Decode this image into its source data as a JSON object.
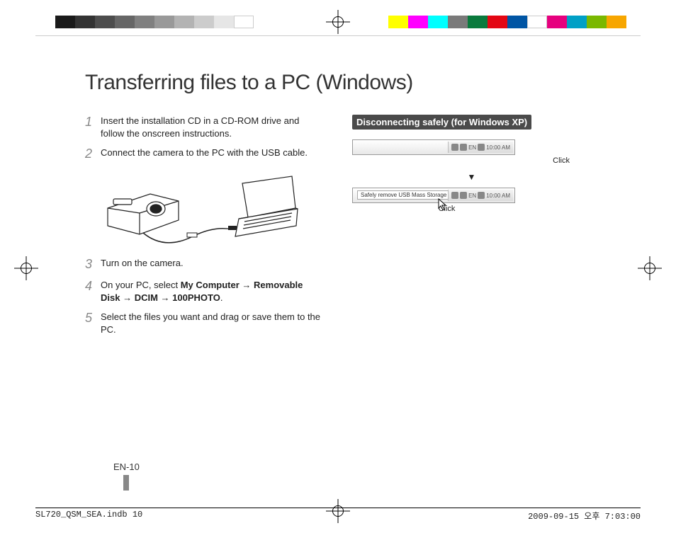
{
  "title": "Transferring files to a PC (Windows)",
  "steps": {
    "s1": {
      "num": "1",
      "text": "Insert the installation CD in a CD-ROM drive and follow the onscreen instructions."
    },
    "s2": {
      "num": "2",
      "text": "Connect the camera to the PC with the USB cable."
    },
    "s3": {
      "num": "3",
      "text": "Turn on the camera."
    },
    "s4": {
      "num": "4",
      "prefix": "On your PC, select ",
      "b1": "My Computer",
      "arr1": " → ",
      "b2": "Removable Disk",
      "arr2": " → ",
      "b3": "DCIM",
      "arr3": " → ",
      "b4": "100PHOTO",
      "suffix": "."
    },
    "s5": {
      "num": "5",
      "text": "Select the files you want and drag or save them to the PC."
    }
  },
  "right": {
    "heading": "Disconnecting safely (for Windows XP)",
    "tray_time": "10:00 AM",
    "tray_lang": "EN",
    "balloon": "Safely remove USB Mass Storage Device - Drive(H:)",
    "click": "Click",
    "arrow": "▼"
  },
  "pagenum": "EN-10",
  "footer": {
    "left": "SL720_QSM_SEA.indb   10",
    "right": "2009-09-15   오후 7:03:00"
  },
  "colorbar_gray": [
    "#1a1a1a",
    "#333",
    "#4d4d4d",
    "#666",
    "#808080",
    "#999",
    "#b3b3b3",
    "#ccc",
    "#e6e6e6",
    "#fff"
  ],
  "colorbar_color": [
    "#ff0",
    "#f0f",
    "#0ff",
    "#7a7a7a",
    "#0a7a3d",
    "#e30613",
    "#0055a4",
    "#fff",
    "#e6007e",
    "#00a0c6",
    "#7ab800",
    "#f7a600"
  ]
}
